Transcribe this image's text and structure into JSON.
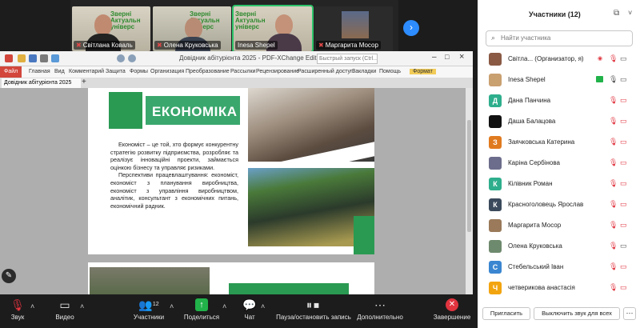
{
  "video_strip": {
    "tiles": [
      {
        "name": "Світлана Коваль",
        "poster": "Зверні Актуальн універс"
      },
      {
        "name": "Олена Круковська",
        "poster": "Зверні Актуальн універс"
      },
      {
        "name": "Inesa Shepel",
        "poster": "Зверні Актуальн універс"
      },
      {
        "name": "Маргарита Мосор",
        "poster": ""
      }
    ]
  },
  "editor": {
    "window_title": "Довідник абітурієнта 2025 - PDF-XChange Editor",
    "quick_launch": "Быстрый запуск (Ctrl...",
    "menu": [
      "Файл",
      "Главная",
      "Вид",
      "Комментарий",
      "Защита",
      "Формы",
      "Организация",
      "Преобразование",
      "Рассылки",
      "Рецензирование",
      "Расширенный доступ",
      "Закладки",
      "Помощь",
      "Формат"
    ],
    "doc_tab": "Довідник абітурієнта 2025",
    "page": {
      "heading": "ЕКОНОМІКА",
      "paragraph1": "Економіст – це той, хто формує конкурентну стратегію розвитку підприємства, розробляє та реалізує інноваційні проекти, займається оцінкою бізнесу та управляє ризиками.",
      "paragraph2": "Перспективи працевлаштування: економіст, економіст з планування виробництва, економіст з управління виробництвом, аналітик, консультант з економічних питань, економічний радник."
    }
  },
  "toolbar": {
    "audio": "Звук",
    "video": "Видео",
    "participants": "Участники",
    "participants_count": "12",
    "share": "Поделиться",
    "chat": "Чат",
    "record": "Пауза/остановить запись",
    "more": "Дополнительно",
    "end": "Завершение"
  },
  "panel": {
    "title": "Участники (12)",
    "search_placeholder": "Найти участника",
    "participants": [
      {
        "name": "Світла... (Организатор, я)",
        "initial": "",
        "color": "#8a5a44"
      },
      {
        "name": "Inesa Shepel",
        "initial": "",
        "color": "#c9a070"
      },
      {
        "name": "Дана Панчина",
        "initial": "Д",
        "color": "#2eae8c"
      },
      {
        "name": "Даша Балацова",
        "initial": "",
        "color": "#111111"
      },
      {
        "name": "Заячковська Катерина",
        "initial": "З",
        "color": "#e07a1f"
      },
      {
        "name": "Каріна Сербінова",
        "initial": "",
        "color": "#6c6c8c"
      },
      {
        "name": "Кілівник Роман",
        "initial": "К",
        "color": "#2eae8c"
      },
      {
        "name": "Красноголовець Ярослав",
        "initial": "К",
        "color": "#3b4a5c"
      },
      {
        "name": "Маргарита Мосор",
        "initial": "",
        "color": "#9a7a5a"
      },
      {
        "name": "Олена Круковська",
        "initial": "",
        "color": "#6e8a6e"
      },
      {
        "name": "Стебельський Іван",
        "initial": "С",
        "color": "#3a86d1"
      },
      {
        "name": "четверикова анастасія",
        "initial": "Ч",
        "color": "#f2a40f"
      }
    ],
    "invite_button": "Пригласить",
    "mute_all_button": "Выключить звук для всех"
  },
  "colors": {
    "accent_green": "#2a9a52",
    "brand_green": "#3aa76d",
    "mic_off_red": "#e0343f",
    "share_green": "#21b24a",
    "blue_nav": "#2d8cff"
  }
}
